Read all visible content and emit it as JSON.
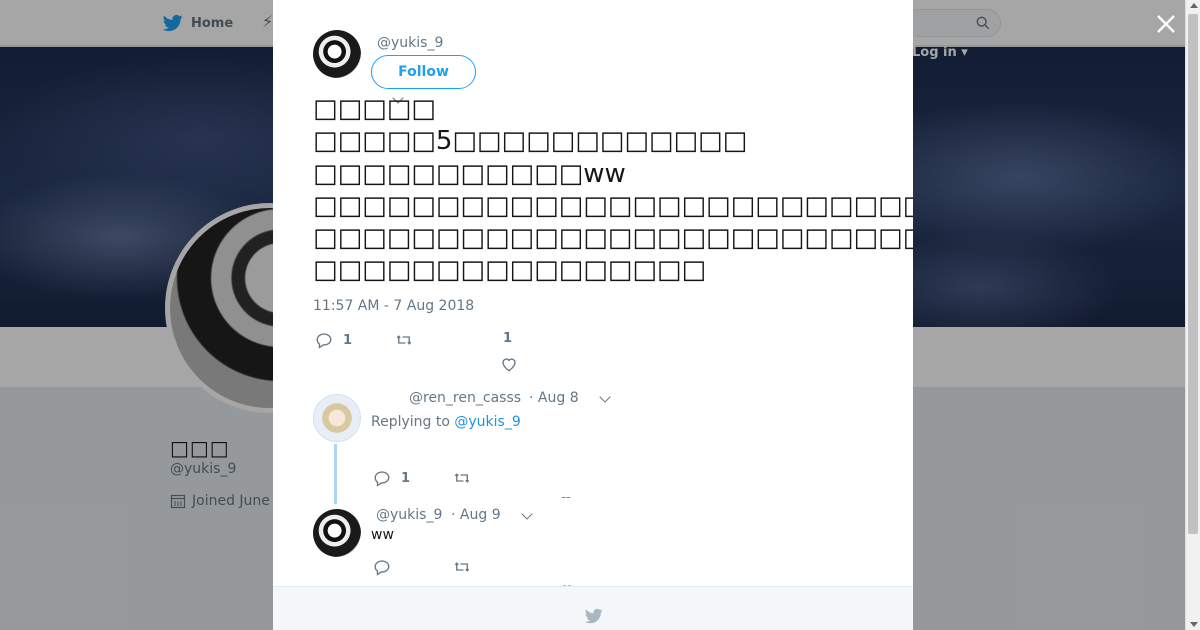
{
  "page": {
    "nav_home": "Home",
    "login_label": "Log in",
    "profile_name": "□□□",
    "profile_handle": "@yukis_9",
    "profile_joined": "Joined June"
  },
  "tweet": {
    "handle": "@yukis_9",
    "follow_label": "Follow",
    "lines": [
      "□□□□□",
      "□□□□□5□□□□□□□□□□□□",
      "□□□□□□□□□□□ww",
      "□□□□□□□□□□□□□□□□□□□□□□□□□",
      "□□□□□□□□□□□□□□□□□□□□□□□□□□□□□",
      "□□□□□□□□□□□□□□□□"
    ],
    "timestamp": "11:57 AM - 7 Aug 2018",
    "reply_count": "1",
    "retweet_count": "",
    "like_count": "1"
  },
  "replies": [
    {
      "handle": "@ren_ren_casss",
      "date": "· Aug 8",
      "replying_prefix": "Replying to",
      "replying_to": "@yukis_9",
      "reply_count": "1"
    },
    {
      "handle": "@yukis_9",
      "date": "· Aug 9",
      "text": "ww"
    }
  ],
  "colors": {
    "accent": "#1da1f2",
    "thread_line": "#a5d8f5",
    "muted": "#657786"
  }
}
